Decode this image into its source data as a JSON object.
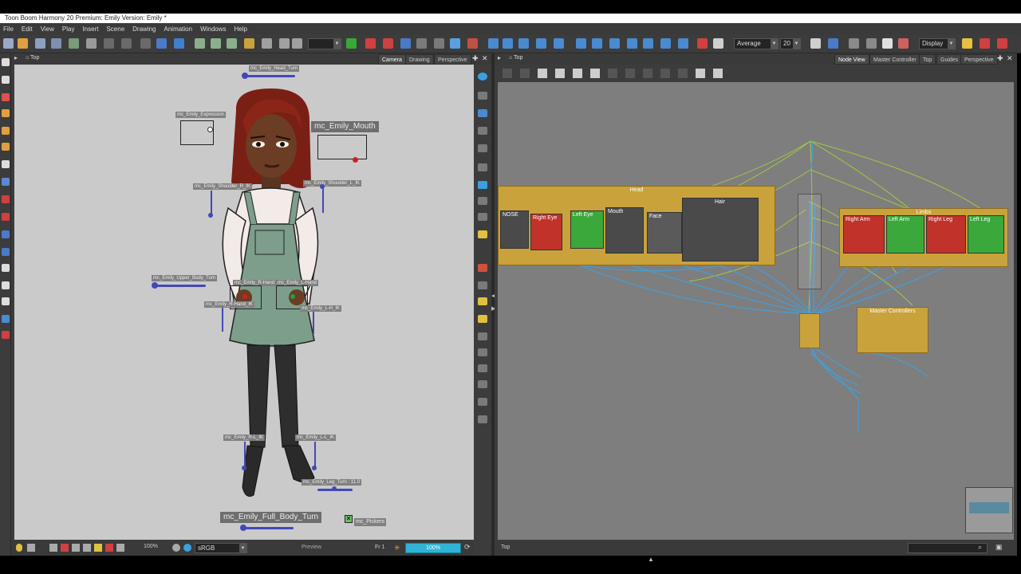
{
  "window": {
    "title": "Toon Boom Harmony 20 Premium: Emily Version: Emily *"
  },
  "menu": [
    "File",
    "Edit",
    "View",
    "Play",
    "Insert",
    "Scene",
    "Drawing",
    "Animation",
    "Windows",
    "Help"
  ],
  "toolbar": {
    "filter_select": "Average",
    "filter_value": "20",
    "display_select": "Display"
  },
  "camera_panel": {
    "breadcrumb": "Top",
    "tabs": [
      "Camera",
      "Drawing",
      "Perspective"
    ],
    "active_tab": "Camera",
    "status": {
      "zoom": "100%",
      "colorspace": "sRGB",
      "mode": "Preview",
      "frame": "Fr 1",
      "zoom_readout": "100%"
    }
  },
  "controllers": {
    "head_turn": "mc_Emily_Head_Turn",
    "expression": "mc_Emily_Expression",
    "mouth": "mc_Emily_Mouth",
    "shoulder_r": "mc_Emily_Shoulder_R_IK",
    "shoulder_l": "mc_Emily_Shoulder_L_IK",
    "upper_body": "mc_Emily_Upper_Body_Turn",
    "hand_r": "mc_Emily_R-Hand",
    "hand_l": "mc_Emily_L-Hand",
    "arm_r": "mc_Emily_R-Hand_IK",
    "arm_l": "mc_Emily_L-H_IK",
    "leg_r": "mc_Emily_R-L_IK",
    "leg_l": "mc_Emily_L-L_IK",
    "leg_turn": "mc_Emily_Leg_Turn : 11.0",
    "full_body": "mc_Emily_Full_Body_Turn",
    "pickers": "mc_Pickers"
  },
  "node_panel": {
    "breadcrumb": "Top",
    "tabs": [
      "Node View",
      "Master Controller",
      "Top",
      "Guides",
      "Perspective"
    ],
    "active_tab": "Node View",
    "status_text": "Top",
    "groups": {
      "head": "Head",
      "limbs": "Limbs",
      "master": "Master Controllers"
    },
    "nodes": {
      "nose": "NOSE",
      "right_eye": "Right Eye",
      "left_eye": "Left Eye",
      "mouth": "Mouth",
      "face": "Face",
      "hair": "Hair",
      "right_arm": "Right Arm",
      "left_arm": "Left Arm",
      "right_leg": "Right Leg",
      "left_leg": "Left Leg"
    }
  },
  "colors": {
    "group_orange": "#c9a23c",
    "node_red": "#c0322a",
    "node_green": "#3aa83a",
    "node_dark": "#4a4a4a",
    "wire_blue": "#3fa0e0",
    "wire_green": "#a6d23a",
    "controller_blue": "#4447b8"
  }
}
